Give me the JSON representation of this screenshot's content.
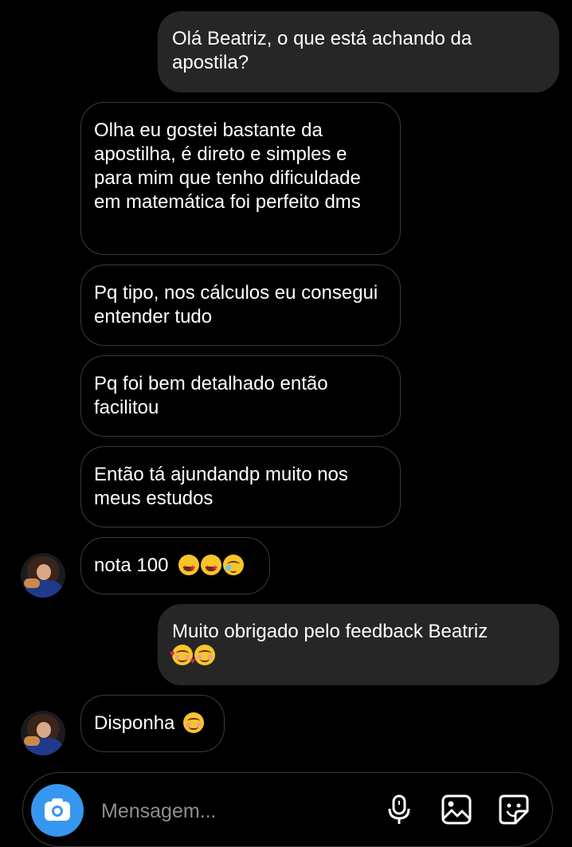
{
  "messages": [
    {
      "id": "m1",
      "sender": "me",
      "text": "Olá Beatriz, o que está achando da apostila?"
    },
    {
      "id": "m2",
      "sender": "them",
      "text": "Olha eu gostei bastante da apostilha, é direto e simples e para mim que tenho dificuldade em matemática foi perfeito dms"
    },
    {
      "id": "m3",
      "sender": "them",
      "text": "Pq tipo, nos cálculos eu consegui entender tudo"
    },
    {
      "id": "m4",
      "sender": "them",
      "text": "Pq foi bem detalhado então facilitou"
    },
    {
      "id": "m5",
      "sender": "them",
      "text": "Então tá ajundandp muito nos meus estudos"
    },
    {
      "id": "m6",
      "sender": "them",
      "text": "nota 100",
      "emojis": [
        "star-struck-emoji",
        "star-struck-emoji",
        "holding-back-tears-emoji"
      ]
    },
    {
      "id": "m7",
      "sender": "me",
      "text": "Muito obrigado pelo feedback Beatriz",
      "emojis": [
        "smiling-face-with-hearts-emoji",
        "smiling-face-emoji"
      ]
    },
    {
      "id": "m8",
      "sender": "them",
      "text": "Disponha",
      "emojis": [
        "smiling-face-emoji"
      ]
    }
  ],
  "composer": {
    "placeholder": "Mensagem...",
    "icons": [
      "camera-icon",
      "microphone-icon",
      "gallery-icon",
      "sticker-icon"
    ],
    "accent_color": "#3797f0"
  },
  "colors": {
    "background": "#000000",
    "sent_bubble": "#262626",
    "received_border": "#3a3a3a"
  }
}
